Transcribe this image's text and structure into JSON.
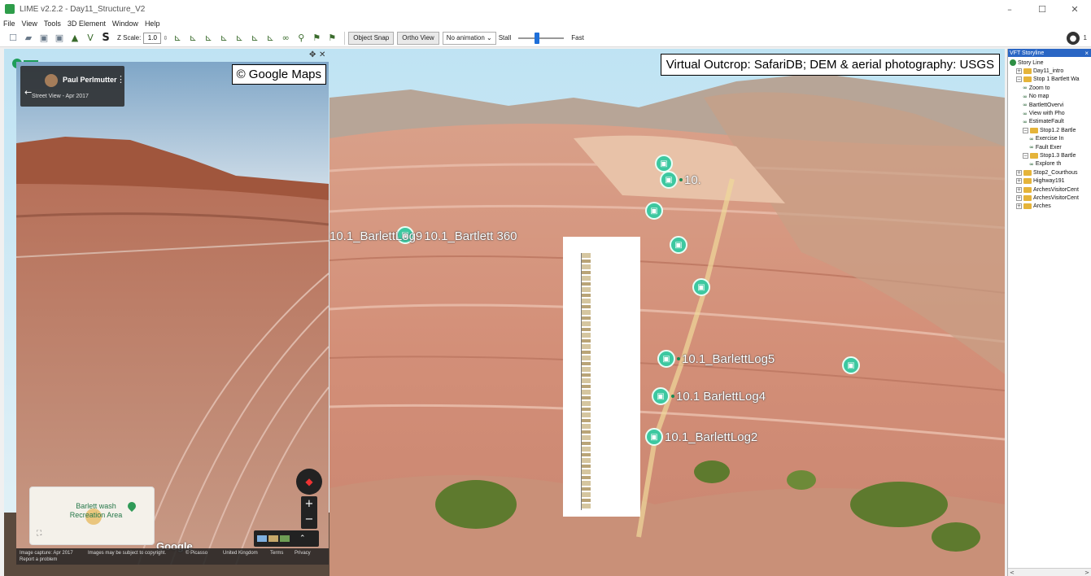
{
  "window": {
    "title": "LIME v2.2.2 - Day11_Structure_V2",
    "minimize": "–",
    "maximize": "☐",
    "close": "✕"
  },
  "menu": [
    "File",
    "View",
    "Tools",
    "3D Element",
    "Window",
    "Help"
  ],
  "toolbar": {
    "zscale_label": "Z Scale:",
    "zscale_value": "1.0",
    "object_snap": "Object Snap",
    "ortho_view": "Ortho View",
    "animation_select": "No animation",
    "stall_label": "Stall",
    "fast_label": "Fast",
    "slider_value": 0.35,
    "user_count": "1"
  },
  "viewport": {
    "caption": "Virtual Outcrop: SafariDB; DEM & aerial photography: USGS",
    "markers": [
      {
        "label": "10.1_BarlettLog9"
      },
      {
        "label": "10.1_Bartlett 360"
      },
      {
        "label": "10."
      },
      {
        "label": "10.1_BarlettLog5"
      },
      {
        "label": "10.1 BarlettLog4"
      },
      {
        "label": "10.1_BarlettLog2"
      }
    ]
  },
  "streetview": {
    "copyright": "© Google Maps",
    "author": "Paul Perlmutter",
    "date": "Street View - Apr 2017",
    "minimap_label": "Barlett wash Recreation Area",
    "google_logo": "Google",
    "footer": {
      "capture": "Image capture: Apr 2017",
      "copyright_notice": "Images may be subject to copyright.",
      "picasso": "© Picasso",
      "region": "United Kingdom",
      "terms": "Terms",
      "privacy": "Privacy",
      "report": "Report a problem"
    }
  },
  "panel": {
    "title": "VFT Storyline",
    "close": "×",
    "tree": [
      {
        "label": "Story Line",
        "indent": 0,
        "type": "root"
      },
      {
        "label": "Day11_intro",
        "indent": 1,
        "type": "folder",
        "toggle": "+"
      },
      {
        "label": "Stop 1 Bartlett Wa",
        "indent": 1,
        "type": "folder",
        "toggle": "−"
      },
      {
        "label": "Zoom to",
        "indent": 2,
        "type": "view"
      },
      {
        "label": "No map",
        "indent": 2,
        "type": "view"
      },
      {
        "label": "BartlettOvervi",
        "indent": 2,
        "type": "view"
      },
      {
        "label": "View with Pho",
        "indent": 2,
        "type": "view"
      },
      {
        "label": "EstimateFault",
        "indent": 2,
        "type": "view"
      },
      {
        "label": "Stop1.2 Bartle",
        "indent": 2,
        "type": "folder",
        "toggle": "−"
      },
      {
        "label": "Exercise In",
        "indent": 3,
        "type": "view"
      },
      {
        "label": "Fault Exer",
        "indent": 3,
        "type": "view"
      },
      {
        "label": "Stop1.3 Bartle",
        "indent": 2,
        "type": "folder",
        "toggle": "−"
      },
      {
        "label": "Explore th",
        "indent": 3,
        "type": "view"
      },
      {
        "label": "Stop2_Courthous",
        "indent": 1,
        "type": "folder",
        "toggle": "+"
      },
      {
        "label": "Highway191",
        "indent": 1,
        "type": "folder",
        "toggle": "+"
      },
      {
        "label": "ArchesVisitorCent",
        "indent": 1,
        "type": "folder",
        "toggle": "+"
      },
      {
        "label": "ArchesVisitorCent",
        "indent": 1,
        "type": "folder",
        "toggle": "+"
      },
      {
        "label": "Arches",
        "indent": 1,
        "type": "folder",
        "toggle": "+"
      }
    ],
    "scroll_left": "<",
    "scroll_right": ">"
  },
  "colors": {
    "accent_marker": "#3dc8a0",
    "selection_header": "#2a66c4",
    "slider_thumb": "#1e6fd9"
  }
}
